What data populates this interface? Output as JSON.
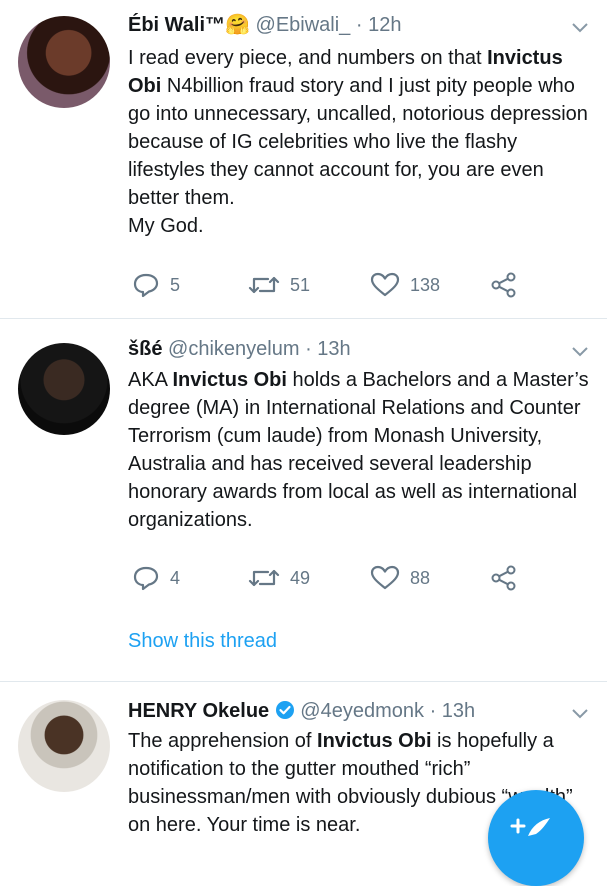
{
  "tweets": [
    {
      "name": "Ébi Wali™",
      "emoji": "🤗",
      "handle": "@Ebiwali_",
      "time": "12h",
      "text_parts": [
        "I read every piece, and numbers on that ",
        "Invictus Obi",
        " N4billion fraud story and I just pity people who go into unnecessary, uncalled, notorious depression because of  IG celebrities who live the flashy lifestyles they cannot account for, you are even better them.",
        "My God."
      ],
      "replies": "5",
      "retweets": "51",
      "likes": "138"
    },
    {
      "name": "šßé",
      "handle": "@chikenyelum",
      "time": "13h",
      "text_parts": [
        "AKA ",
        "Invictus Obi",
        " holds a Bachelors and a Master’s degree (MA) in International Relations and Counter Terrorism (cum laude) from Monash University, Australia and has received several leadership honorary awards from local as well as international organizations."
      ],
      "replies": "4",
      "retweets": "49",
      "likes": "88",
      "thread_link": "Show this thread"
    },
    {
      "name": "HENRY Okelue",
      "verified": true,
      "handle": "@4eyedmonk",
      "time": "13h",
      "text_parts": [
        "The apprehension of ",
        "Invictus Obi",
        " is hopefully a notification to the gutter mouthed “rich” businessman/men with obviously dubious “wealth” on here. Your time is near."
      ]
    }
  ],
  "separator": "·",
  "colors": {
    "accent": "#1da1f2",
    "muted": "#657786",
    "divider": "#e1e8ed"
  }
}
